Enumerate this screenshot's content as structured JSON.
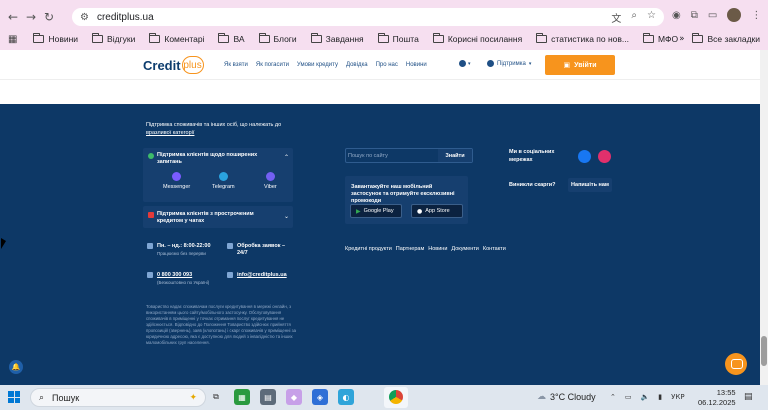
{
  "browser": {
    "url": "creditplus.ua",
    "bookmarks": [
      "Новини",
      "Відгуки",
      "Коментарі",
      "ВА",
      "Блоги",
      "Завдання",
      "Пошта",
      "Корисні посилання",
      "статистика по нов...",
      "МФО"
    ],
    "all_bookmarks": "Все закладки"
  },
  "header": {
    "logo_text": "Credit",
    "logo_plus": "plus",
    "nav": [
      "Як взяти",
      "Як погасити",
      "Умови кредиту",
      "Довідка",
      "Про нас",
      "Новини"
    ],
    "support": "Підтримка",
    "login": "Увійти"
  },
  "footer": {
    "intro": "Підтримка споживачів та інших осіб, що належать до",
    "intro_link": "вразливої категорії",
    "support_box": {
      "title": "Підтримка клієнтів щодо поширених запитань",
      "messengers": [
        "Messenger",
        "Telegram",
        "Viber"
      ]
    },
    "overdue_box": {
      "title": "Підтримка клієнтів з простроченим кредитом у чатах"
    },
    "hours": "Пн. – нд.: 8:00-22:00",
    "hours_sub": "Працюємо без перерви",
    "processing": "Обробка заявок – 24/7",
    "phone": "0 800 300 093",
    "phone_sub": "(Безкоштовно по Україні)",
    "email": "info@creditplus.ua",
    "legal": "Товариство надає споживачам послуги кредитування в мережі онлайн, з використанням цього сайту/мобільного застосунку. Обслуговування споживачів в приміщенні у точках отримання послуг кредитування не здійснюється. Відповідно до Положення Товариство здійснює прийняття пропозицій (звернень), заяв (клопотань) і скарг споживачів у приміщенні за юридичною адресою, яка є доступною для людей з інвалідністю та інших маломобільних груп населення.",
    "search_placeholder": "Пошук по сайту",
    "search_button": "Знайти",
    "app_title": "Завантажуйте наш мобільний застосунок та отримуйте ексклюзивні промокоди",
    "google_play": "Google Play",
    "app_store": "App Store",
    "links": [
      "Кредитні продукти",
      "Партнерам",
      "Новини",
      "Документи",
      "Контакти"
    ],
    "social_title": "Ми в соціальних мережах",
    "complaint": "Виникли скарги?",
    "write_us": "Напишіть нам"
  },
  "taskbar": {
    "search": "Пошук",
    "weather": "3°C  Cloudy",
    "lang": "УКР",
    "time": "13:55",
    "date": "06.12.2025"
  },
  "colors": {
    "footer_bg": "#0d3866",
    "accent": "#f7941d",
    "chrome_bg": "#f6dff0"
  }
}
